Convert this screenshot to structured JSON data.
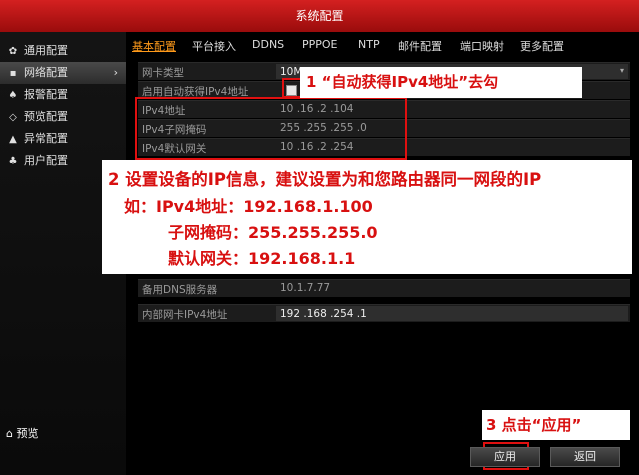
{
  "window": {
    "title": "系统配置"
  },
  "sidebar": {
    "items": [
      {
        "label": "通用配置",
        "icon": "gear-icon",
        "glyph": "✿"
      },
      {
        "label": "网络配置",
        "icon": "network-icon",
        "glyph": "▪",
        "active": true
      },
      {
        "label": "报警配置",
        "icon": "alarm-icon",
        "glyph": "♠"
      },
      {
        "label": "预览配置",
        "icon": "eye-icon",
        "glyph": "◇"
      },
      {
        "label": "异常配置",
        "icon": "warning-icon",
        "glyph": "▲"
      },
      {
        "label": "用户配置",
        "icon": "users-icon",
        "glyph": "♣"
      }
    ],
    "preview": {
      "label": "预览",
      "glyph": "⌂"
    }
  },
  "tabs": [
    "基本配置",
    "平台接入",
    "DDNS",
    "PPPOE",
    "NTP",
    "邮件配置",
    "端口映射",
    "更多配置"
  ],
  "form": {
    "nic_type": {
      "label": "网卡类型",
      "value": "10M"
    },
    "dhcp": {
      "label": "启用自动获得IPv4地址",
      "checked": false
    },
    "ipv4_address": {
      "label": "IPv4地址",
      "value": "10  .16  .2    .104"
    },
    "ipv4_subnet": {
      "label": "IPv4子网掩码",
      "value": "255 .255 .255 .0"
    },
    "ipv4_gateway": {
      "label": "IPv4默认网关",
      "value": "10  .16  .2    .254"
    },
    "backup_dns": {
      "label": "备用DNS服务器",
      "value": "10.1.7.77"
    },
    "internal_nic": {
      "label": "内部网卡IPv4地址",
      "value": "192 .168 .254 .1"
    }
  },
  "annotations": {
    "step1": "1 “自动获得IPv4地址”去勾",
    "step2_line1": "2 设置设备的IP信息，建议设置为和您路由器同一网段的IP",
    "step2_line2": "如：IPv4地址：192.168.1.100",
    "step2_line3": "子网掩码：255.255.255.0",
    "step2_line4": "默认网关：192.168.1.1",
    "step3": "3 点击“应用”"
  },
  "buttons": {
    "apply": "应用",
    "back": "返回"
  },
  "colors": {
    "title_bar": "#c01414",
    "active_tab": "#ff9a1a",
    "annotation_red": "#d81010"
  }
}
